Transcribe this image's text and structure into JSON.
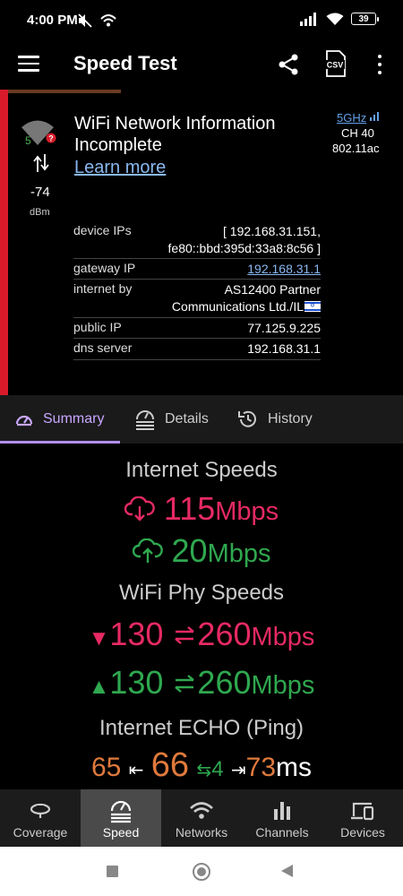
{
  "status_bar": {
    "time": "4:00 PM",
    "battery": "39"
  },
  "app_bar": {
    "title": "Speed Test"
  },
  "network": {
    "signal_level": "5",
    "rssi": "-74",
    "rssi_unit": "dBm",
    "title": "WiFi Network Information Incomplete",
    "learn_more": "Learn more",
    "band": "5GHz",
    "channel": "CH 40",
    "standard": "802.11ac"
  },
  "info": {
    "device_ips_label": "device IPs",
    "device_ips_line1": "[ 192.168.31.151,",
    "device_ips_line2": "fe80::bbd:395d:33a8:8c56 ]",
    "gateway_label": "gateway IP",
    "gateway_value": "192.168.31.1",
    "internet_label": "internet by",
    "internet_line1": "AS12400 Partner",
    "internet_line2": "Communications Ltd./IL",
    "public_label": "public IP",
    "public_value": "77.125.9.225",
    "dns_label": "dns server",
    "dns_value": "192.168.31.1"
  },
  "tabs": [
    {
      "label": "Summary",
      "active": true
    },
    {
      "label": "Details"
    },
    {
      "label": "History"
    }
  ],
  "summary": {
    "internet_heading": "Internet Speeds",
    "download_value": "115",
    "download_unit": "Mbps",
    "upload_value": "20",
    "upload_unit": "Mbps",
    "phy_heading": "WiFi Phy Speeds",
    "phy_down_current": "130",
    "phy_down_max": "260",
    "phy_down_unit": "Mbps",
    "phy_up_current": "130",
    "phy_up_max": "260",
    "phy_up_unit": "Mbps",
    "ping_heading": "Internet ECHO (Ping)",
    "ping_min": "65",
    "ping_avg": "66",
    "ping_jitter": "4",
    "ping_max": "73",
    "ping_unit": "ms"
  },
  "bottom_nav": [
    {
      "label": "Coverage"
    },
    {
      "label": "Speed",
      "active": true
    },
    {
      "label": "Networks"
    },
    {
      "label": "Channels"
    },
    {
      "label": "Devices"
    }
  ],
  "colors": {
    "accent": "#b28df0",
    "download": "#e62a63",
    "upload": "#2fa84f",
    "ping": "#e07a3c",
    "signal_bar": "#d81b2a"
  }
}
